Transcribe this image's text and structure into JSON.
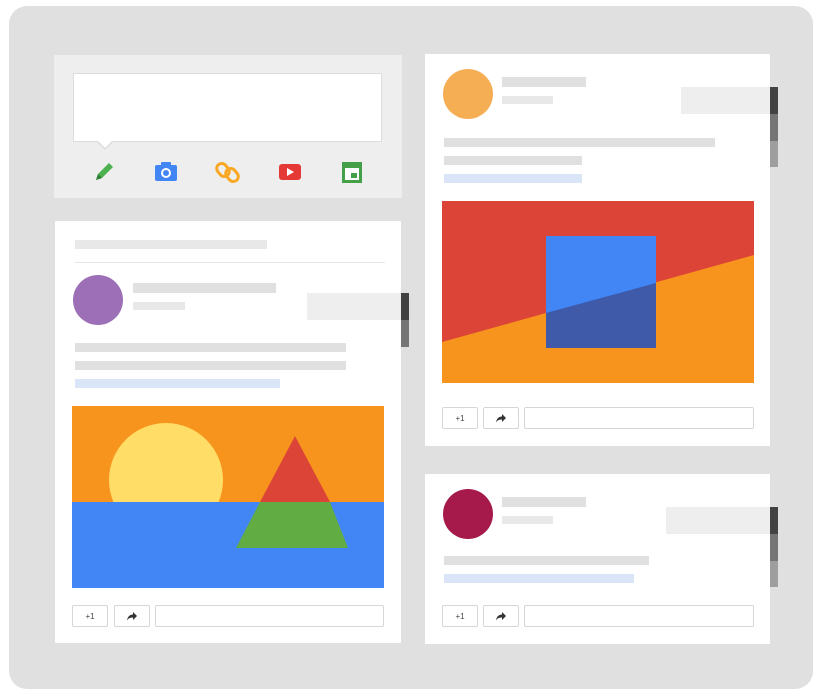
{
  "composer": {
    "tools": [
      {
        "icon": "pencil-icon",
        "color": "#4caf50"
      },
      {
        "icon": "camera-icon",
        "color": "#4285f4"
      },
      {
        "icon": "link-icon",
        "color": "#f9a825"
      },
      {
        "icon": "youtube-icon",
        "color": "#e53935"
      },
      {
        "icon": "event-icon",
        "color": "#43a047"
      }
    ]
  },
  "post_actions": {
    "plus_one_label": "+1",
    "share_icon": "share-icon"
  },
  "posts": [
    {
      "id": "left",
      "avatar_color": "#9c6fb6",
      "image": "sunset-triangle"
    },
    {
      "id": "right-top",
      "avatar_color": "#f6ae55",
      "image": "abstract-square"
    },
    {
      "id": "right-bottom",
      "avatar_color": "#a51a4a"
    }
  ],
  "colors": {
    "background": "#e0e0e0",
    "card": "#ffffff",
    "placeholder": "#e0e0e0",
    "link_placeholder": "#dae5f8",
    "orange": "#f7941d",
    "blue": "#4285f4",
    "red": "#db4437",
    "green": "#62ac44",
    "yellow": "#ffdd66",
    "navy": "#3f5aa8"
  }
}
